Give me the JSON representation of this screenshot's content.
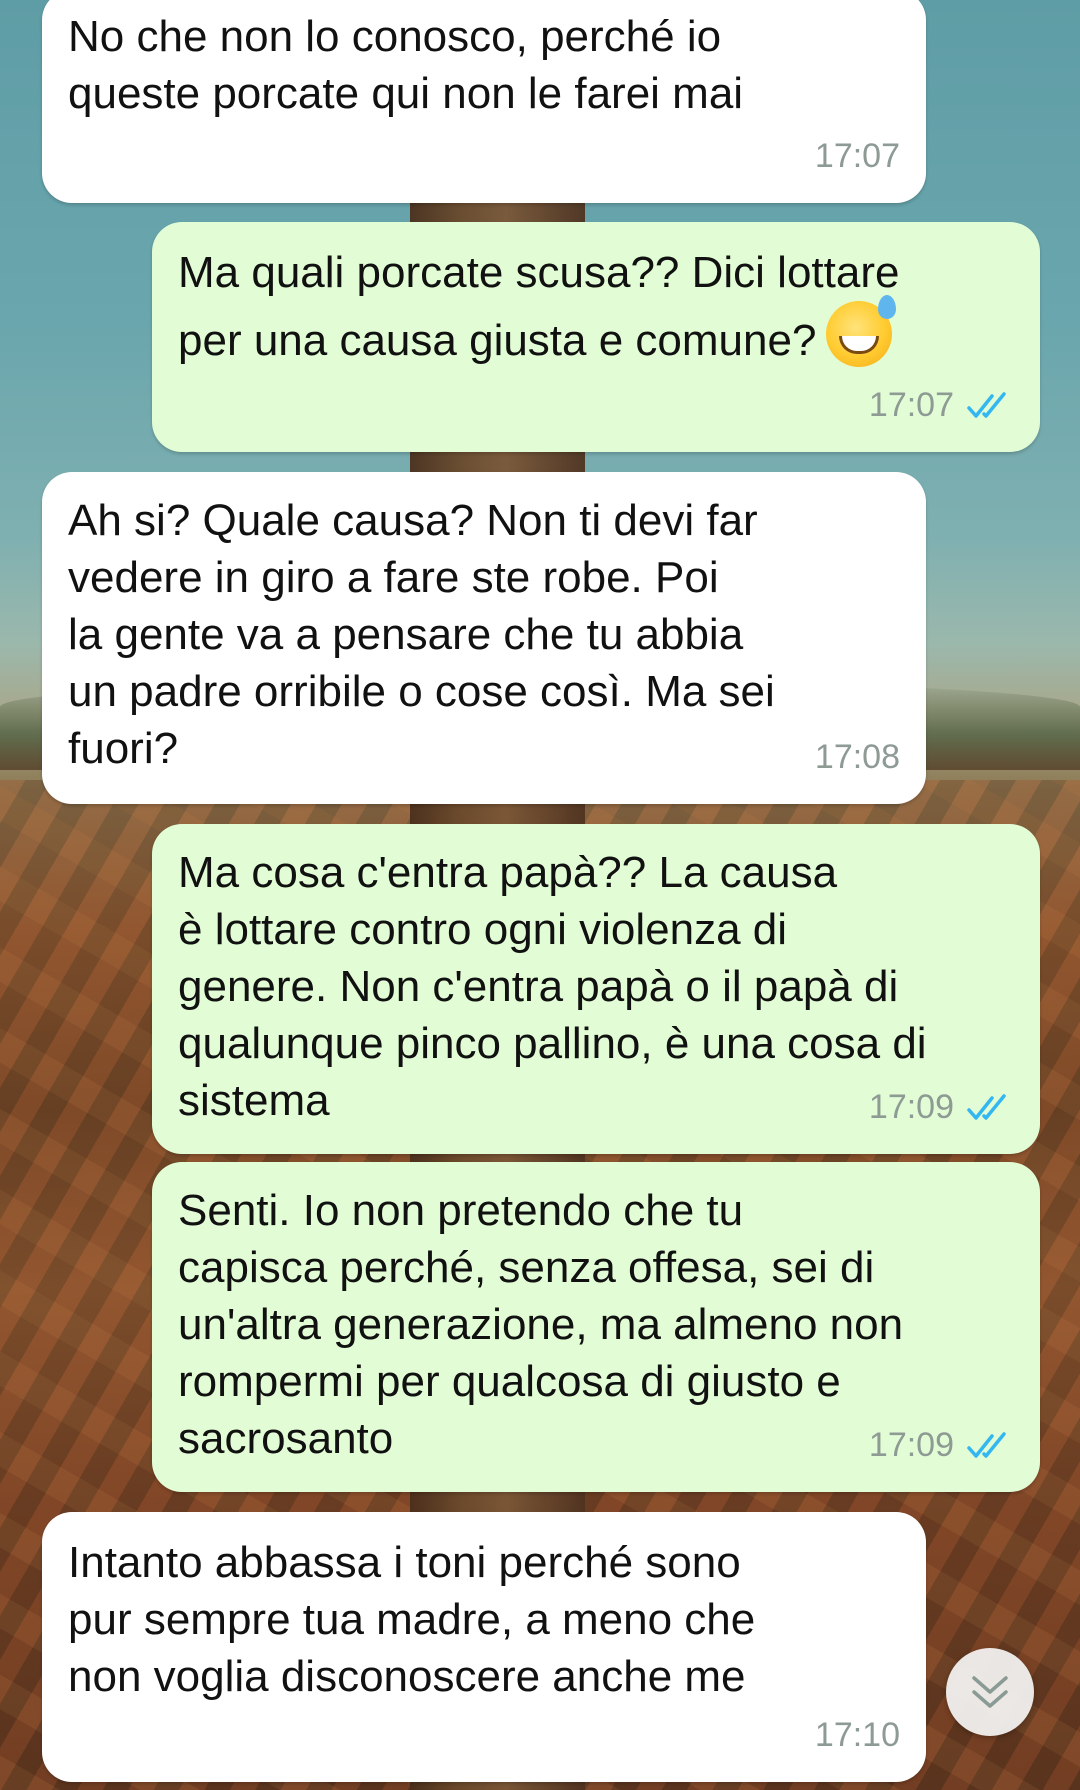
{
  "messages": [
    {
      "direction": "incoming",
      "text": "No che non lo conosco, perché io\nqueste porcate qui non le farei mai",
      "time": "17:07"
    },
    {
      "direction": "outgoing",
      "text": "Ma quali porcate scusa?? Dici lottare\nper una causa giusta e comune?",
      "emoji": "grinning-face-with-sweat",
      "time": "17:07",
      "status": "read"
    },
    {
      "direction": "incoming",
      "text": "Ah si? Quale causa? Non ti devi far\nvedere in giro a fare ste robe. Poi\nla gente va a pensare che tu abbia\nun padre orribile o cose così. Ma sei\nfuori?",
      "time": "17:08"
    },
    {
      "direction": "outgoing",
      "text": "Ma cosa c'entra papà?? La causa\nè lottare contro ogni violenza di\ngenere. Non c'entra papà o il papà di\nqualunque pinco pallino, è una cosa di\nsistema",
      "time": "17:09",
      "status": "read"
    },
    {
      "direction": "outgoing",
      "text": "Senti. Io non pretendo che tu\ncapisca perché, senza offesa, sei di\nun'altra generazione, ma almeno non\nrompermi per qualcosa di giusto e\nsacrosanto",
      "time": "17:09",
      "status": "read"
    },
    {
      "direction": "incoming",
      "text": "Intanto abbassa i toni perché sono\npur sempre tua madre, a meno che\nnon voglia disconoscere anche me",
      "time": "17:10"
    }
  ],
  "controls": {
    "scroll_down_icon": "double-chevron-down-icon"
  },
  "colors": {
    "incoming_bubble": "#ffffff",
    "outgoing_bubble": "#e2fdd5",
    "read_ticks": "#34b7f1",
    "time_text": "#8e9a94"
  }
}
